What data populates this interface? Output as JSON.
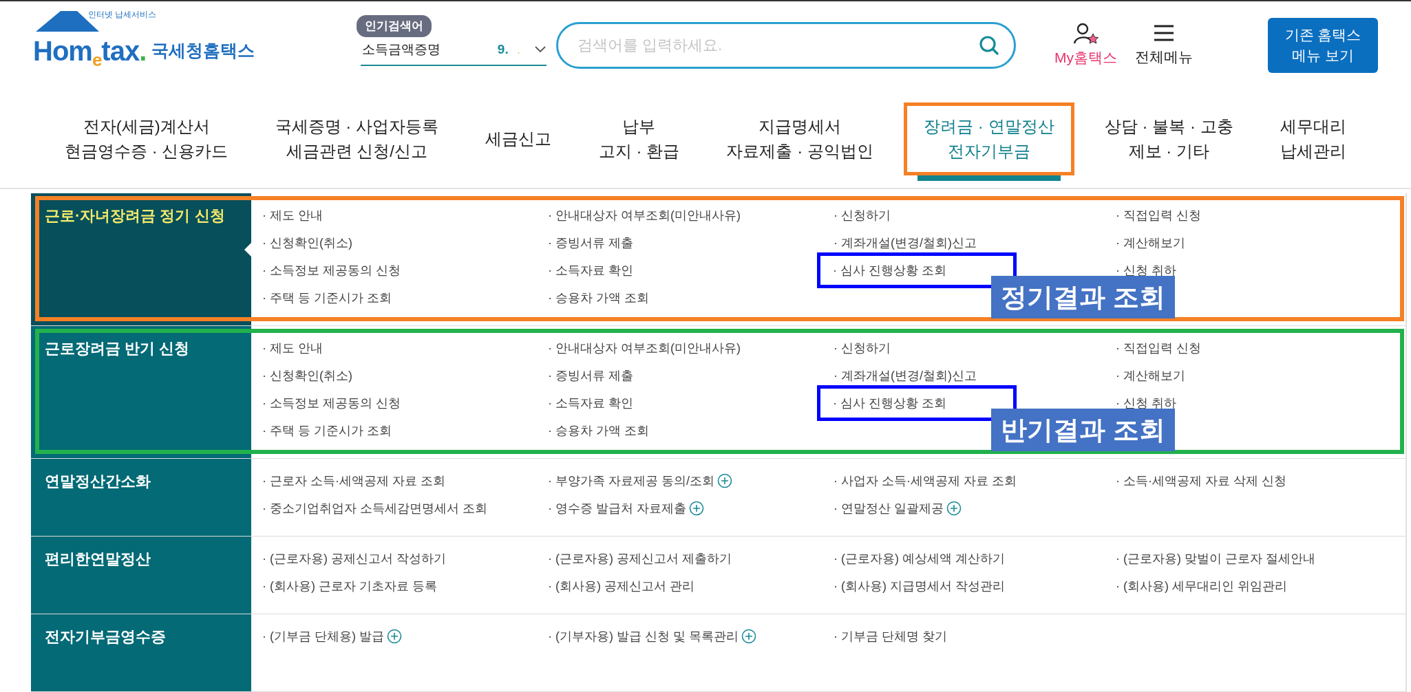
{
  "header": {
    "logo": {
      "tagline": "인터넷 납세서비스",
      "parts": [
        "Hom",
        "e",
        "tax",
        "."
      ],
      "name": "국세청홈택스"
    },
    "popular": {
      "badge": "인기검색어",
      "term": "소득금액증명",
      "rank": "9.",
      "dot": "."
    },
    "search": {
      "placeholder": "검색어를 입력하세요."
    },
    "my": "My홈택스",
    "all_menu": "전체메뉴",
    "legacy_button": "기존 홈택스\n메뉴 보기"
  },
  "nav": [
    {
      "label": "전자(세금)계산서\n현금영수증 · 신용카드",
      "selected": false
    },
    {
      "label": "국세증명 · 사업자등록\n세금관련 신청/신고",
      "selected": false
    },
    {
      "label": "세금신고",
      "selected": false
    },
    {
      "label": "납부\n고지 · 환급",
      "selected": false
    },
    {
      "label": "지급명세서\n자료제출 · 공익법인",
      "selected": false
    },
    {
      "label": "장려금 · 연말정산\n전자기부금",
      "selected": true,
      "frame": {
        "color": "#f58025"
      }
    },
    {
      "label": "상담 · 불복 · 고충\n제보 · 기타",
      "selected": false
    },
    {
      "label": "세무대리\n납세관리",
      "selected": false
    }
  ],
  "groups": [
    {
      "title": "근로·자녀장려금 정기 신청",
      "selected": true,
      "frame": {
        "color": "#f58025"
      },
      "callout": "정기결과 조회",
      "items": [
        {
          "text": "· 제도 안내"
        },
        {
          "text": "· 안내대상자 여부조회(미안내사유)"
        },
        {
          "text": "· 신청하기"
        },
        {
          "text": "· 직접입력 신청"
        },
        {
          "text": "· 신청확인(취소)"
        },
        {
          "text": "· 증빙서류 제출"
        },
        {
          "text": "· 계좌개설(변경/철회)신고"
        },
        {
          "text": "· 계산해보기"
        },
        {
          "text": "· 소득정보 제공동의 신청"
        },
        {
          "text": "· 소득자료 확인"
        },
        {
          "text": "· 심사 진행상황 조회",
          "marked": true
        },
        {
          "text": "· 신청 취하"
        },
        {
          "text": "· 주택 등 기준시가 조회"
        },
        {
          "text": "· 승용차 가액 조회"
        }
      ]
    },
    {
      "title": "근로장려금 반기 신청",
      "selected": false,
      "frame": {
        "color": "#22b14c"
      },
      "callout": "반기결과 조회",
      "items": [
        {
          "text": "· 제도 안내"
        },
        {
          "text": "· 안내대상자 여부조회(미안내사유)"
        },
        {
          "text": "· 신청하기"
        },
        {
          "text": "· 직접입력 신청"
        },
        {
          "text": "· 신청확인(취소)"
        },
        {
          "text": "· 증빙서류 제출"
        },
        {
          "text": "· 계좌개설(변경/철회)신고"
        },
        {
          "text": "· 계산해보기"
        },
        {
          "text": "· 소득정보 제공동의 신청"
        },
        {
          "text": "· 소득자료 확인"
        },
        {
          "text": "· 심사 진행상황 조회",
          "marked": true
        },
        {
          "text": "· 신청 취하"
        },
        {
          "text": "· 주택 등 기준시가 조회"
        },
        {
          "text": "· 승용차 가액 조회"
        }
      ]
    },
    {
      "title": "연말정산간소화",
      "selected": false,
      "items": [
        {
          "text": "· 근로자 소득·세액공제 자료 조회"
        },
        {
          "text": "· 부양가족 자료제공 동의/조회",
          "plus": true
        },
        {
          "text": "· 사업자 소득·세액공제 자료 조회"
        },
        {
          "text": "· 소득·세액공제 자료 삭제 신청"
        },
        {
          "text": "· 중소기업취업자 소득세감면명세서 조회"
        },
        {
          "text": "· 영수증 발급처 자료제출",
          "plus": true
        },
        {
          "text": "· 연말정산 일괄제공",
          "plus": true
        }
      ]
    },
    {
      "title": "편리한연말정산",
      "selected": false,
      "items": [
        {
          "text": "· (근로자용) 공제신고서 작성하기"
        },
        {
          "text": "· (근로자용) 공제신고서 제출하기"
        },
        {
          "text": "· (근로자용) 예상세액 계산하기"
        },
        {
          "text": "· (근로자용) 맞벌이 근로자 절세안내"
        },
        {
          "text": "· (회사용) 근로자 기초자료 등록"
        },
        {
          "text": "· (회사용) 공제신고서 관리"
        },
        {
          "text": "· (회사용) 지급명세서 작성관리"
        },
        {
          "text": "· (회사용) 세무대리인 위임관리"
        }
      ]
    },
    {
      "title": "전자기부금영수증",
      "selected": false,
      "items": [
        {
          "text": "· (기부금 단체용) 발급",
          "plus": true
        },
        {
          "text": "· (기부자용) 발급 신청 및 목록관리",
          "plus": true
        },
        {
          "text": "· 기부금 단체명 찾기"
        }
      ]
    }
  ]
}
